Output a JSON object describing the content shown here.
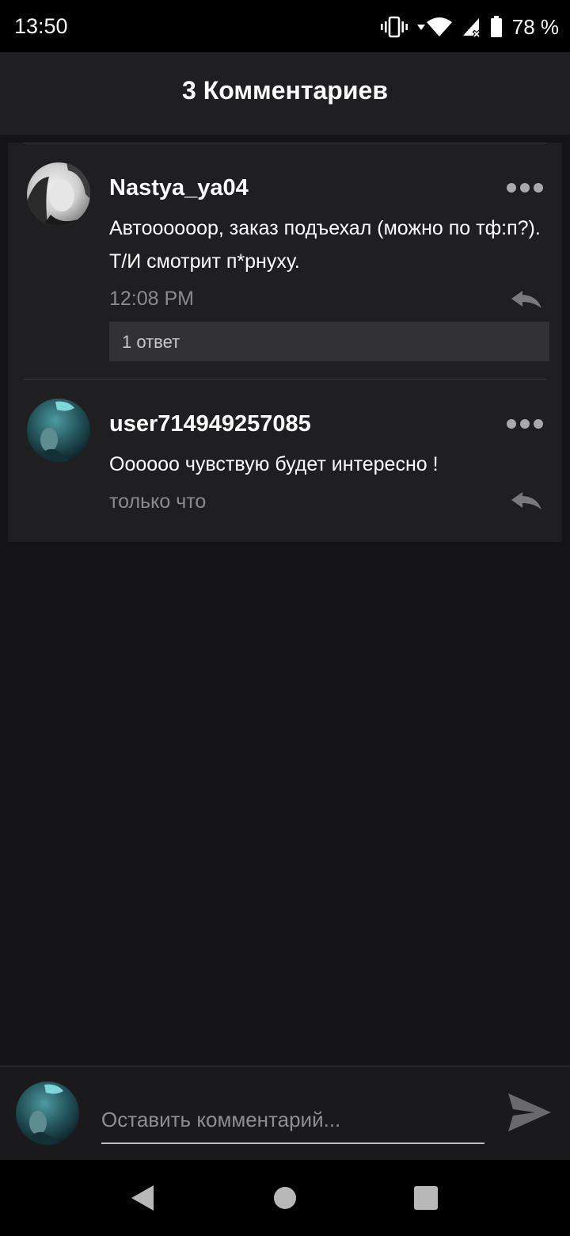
{
  "status_bar": {
    "time": "13:50",
    "battery_percent": "78 %",
    "icons": [
      "vibrate-icon",
      "wifi-icon",
      "cell-signal-icon",
      "battery-icon"
    ]
  },
  "header": {
    "title": "3 Комментариев"
  },
  "comments": [
    {
      "username": "Nastya_ya04",
      "text": "Автоооооор, заказ подъехал (можно по тф:п?). Т/И смотрит п*рнуху.",
      "time": "12:08 PM",
      "replies_label": "1 ответ",
      "avatar": "avatar-photo-grayscale"
    },
    {
      "username": "user714949257085",
      "text": "Оооооо чувствую будет интересно !",
      "time": "только что",
      "avatar": "avatar-photo-teal"
    }
  ],
  "compose": {
    "placeholder": "Оставить комментарий...",
    "send_icon": "send-icon"
  },
  "nav_bar": {
    "icons": [
      "back-icon",
      "home-icon",
      "recents-icon"
    ]
  },
  "colors": {
    "background": "#141316",
    "card": "#1f1e21",
    "muted_text": "#8b8a8e",
    "replies_bar": "#323135"
  }
}
